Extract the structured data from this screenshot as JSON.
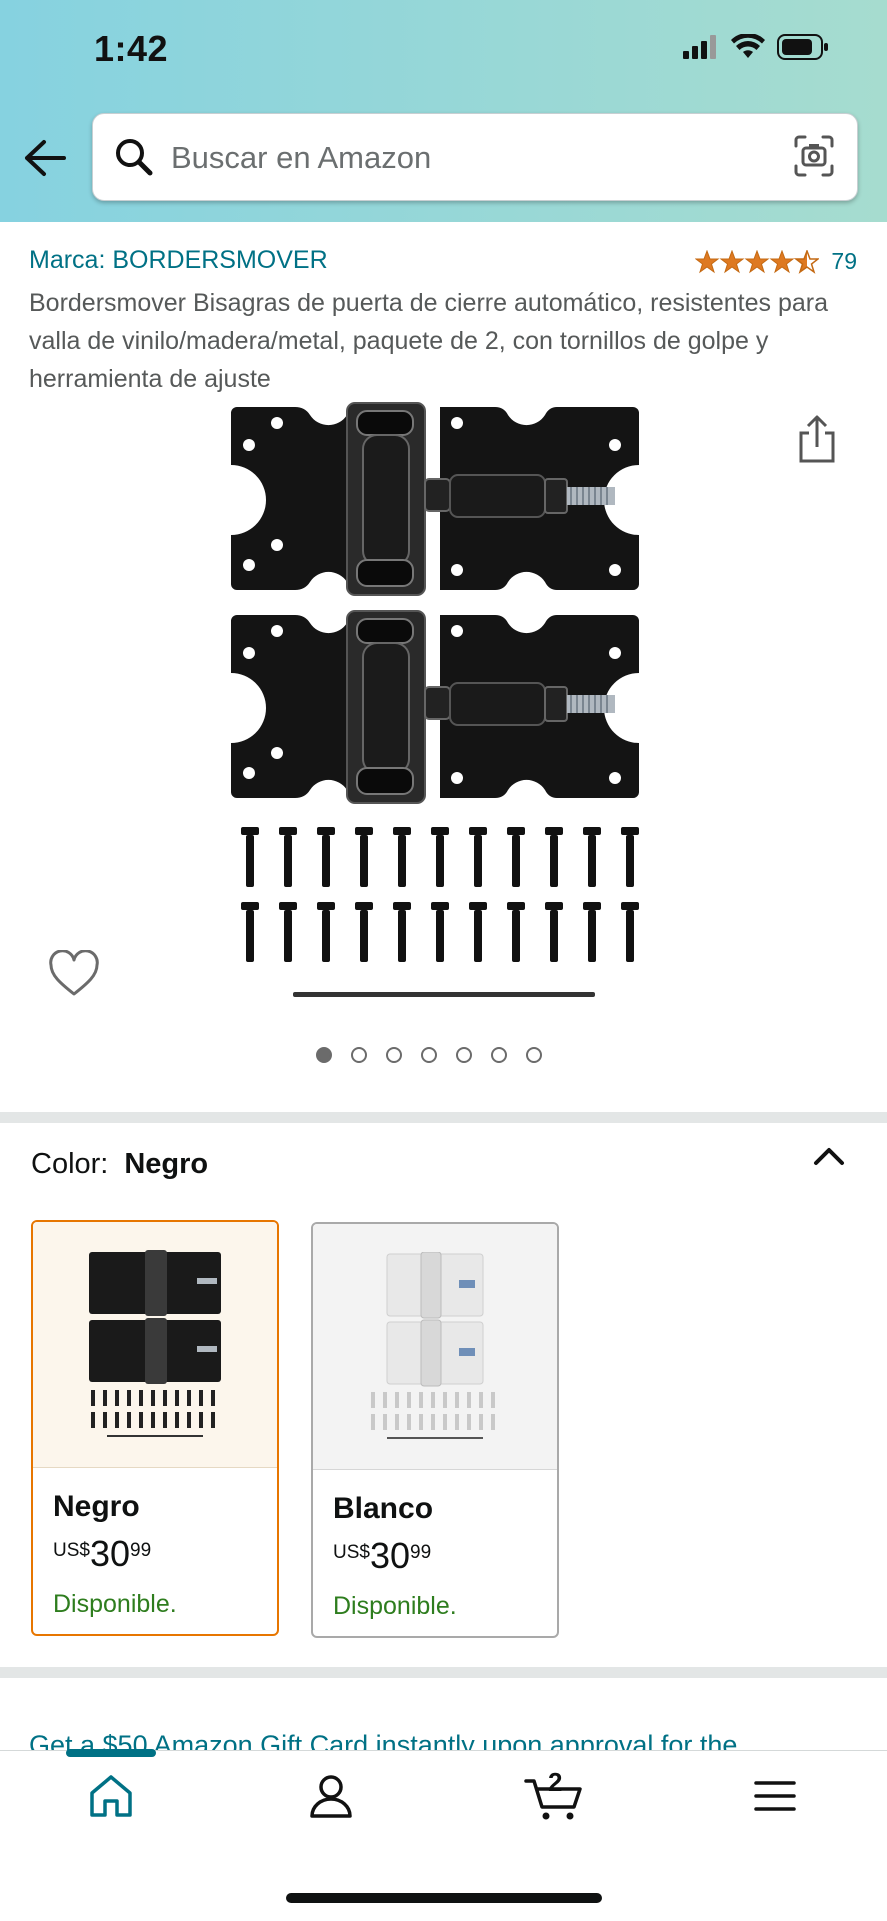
{
  "status_bar": {
    "time": "1:42"
  },
  "search": {
    "placeholder": "Buscar en Amazon",
    "value": ""
  },
  "product": {
    "brand": "Marca: BORDERSMOVER",
    "rating_count": "79",
    "rating_stars": 4.5,
    "title": "Bordersmover Bisagras de puerta de cierre automático, resistentes para valla de vinilo/madera/metal, paquete de 2, con tornillos de golpe y herramienta de ajuste",
    "image_count": 7,
    "active_image": 1
  },
  "color": {
    "label": "Color:",
    "selected": "Negro",
    "options": [
      {
        "name": "Negro",
        "currency": "US$",
        "whole": "30",
        "fraction": "99",
        "availability": "Disponible."
      },
      {
        "name": "Blanco",
        "currency": "US$",
        "whole": "30",
        "fraction": "99",
        "availability": "Disponible."
      }
    ]
  },
  "promo": {
    "text": "Get a $50 Amazon Gift Card instantly upon approval for the"
  },
  "nav": {
    "cart_count": "2",
    "items": [
      "home-icon",
      "account-icon",
      "cart-icon",
      "menu-icon"
    ]
  },
  "colors": {
    "link": "#007185",
    "star": "#de7921",
    "available": "#2e7d1e",
    "selected_border": "#e77600"
  }
}
